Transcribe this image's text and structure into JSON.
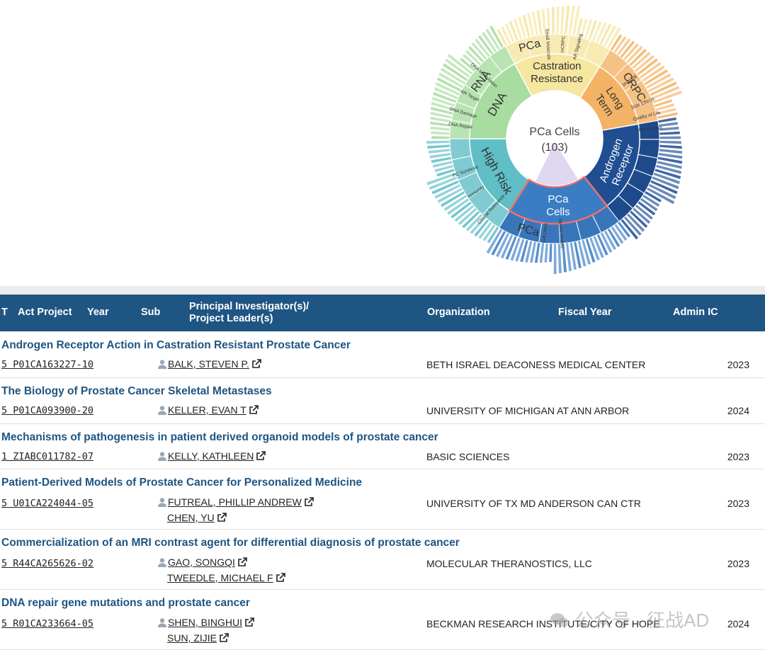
{
  "sunburst": {
    "center_line1": "PCa Cells",
    "center_line2": "(103)",
    "colors": {
      "dna": "#a8dca0",
      "cr": "#f5e6a0",
      "lt": "#f4b266",
      "ar": "#1f4e93",
      "cells": "#3b7dc4",
      "hr": "#5fbec6",
      "center_wedge": "#e0d8f0"
    },
    "inner": [
      {
        "label": [
          "DNA"
        ],
        "color": "#a8dca0",
        "text": "#333"
      },
      {
        "label": [
          "Castration",
          "Resistance"
        ],
        "color": "#f5e6a0",
        "text": "#333"
      },
      {
        "label": [
          "Long",
          "Term"
        ],
        "color": "#f4b266",
        "text": "#333"
      },
      {
        "label": [
          "Androgen",
          "Receptor"
        ],
        "color": "#1f4e93",
        "text": "#ffffff"
      },
      {
        "label": [
          "PCa",
          "Cells"
        ],
        "color": "#3b7dc4",
        "text": "#ffffff"
      },
      {
        "label": [
          "High Risk"
        ],
        "color": "#5fbec6",
        "text": "#333"
      }
    ],
    "outer_labels": [
      "RNA",
      "PCa",
      "CRPC",
      "PCa"
    ],
    "small_labels": [
      "DNA Repair",
      "DNA Damage",
      "AR Target",
      "DNA Methylation",
      "Clinical Trials",
      "Imaging",
      "Side Effects",
      "Quality of Life",
      "mCRPC",
      "Small Molecule",
      "AR Signaling",
      "PC Survivors",
      "Immunity",
      "Clinical Relevance",
      "Cell Lines",
      "Mouse Models"
    ]
  },
  "table": {
    "headers": {
      "t": "T",
      "act_project": "Act Project",
      "year": "Year",
      "sub": "Sub",
      "pi_line1": "Principal Investigator(s)/",
      "pi_line2": "Project Leader(s)",
      "organization": "Organization",
      "fiscal_year": "Fiscal Year",
      "admin_ic": "Admin IC"
    },
    "rows": [
      {
        "title": "Androgen Receptor Action in Castration Resistant Prostate Cancer",
        "project": "5 P01CA163227-10",
        "pis": [
          "BALK, STEVEN P."
        ],
        "org": "BETH ISRAEL DEACONESS MEDICAL CENTER",
        "year": "2023"
      },
      {
        "title": "The Biology of Prostate Cancer Skeletal Metastases",
        "project": "5 P01CA093900-20",
        "pis": [
          "KELLER, EVAN T"
        ],
        "org": "UNIVERSITY OF MICHIGAN AT ANN ARBOR",
        "year": "2024"
      },
      {
        "title": "Mechanisms of pathogenesis in patient derived organoid models of prostate cancer",
        "project": "1 ZIABC011782-07",
        "pis": [
          "KELLY, KATHLEEN"
        ],
        "org": "BASIC SCIENCES",
        "year": "2023"
      },
      {
        "title": "Patient-Derived Models of Prostate Cancer for Personalized Medicine",
        "project": "5 U01CA224044-05",
        "pis": [
          "FUTREAL, PHILLIP ANDREW",
          "CHEN, YU"
        ],
        "org": "UNIVERSITY OF TX MD ANDERSON CAN CTR",
        "year": "2023"
      },
      {
        "title": "Commercialization of an MRI contrast agent for differential diagnosis of prostate cancer",
        "project": "5 R44CA265626-02",
        "pis": [
          "GAO, SONGQI",
          "TWEEDLE, MICHAEL F"
        ],
        "org": "MOLECULAR THERANOSTICS, LLC",
        "year": "2023"
      },
      {
        "title": "DNA repair gene mutations and prostate cancer",
        "project": "5 R01CA233664-05",
        "pis": [
          "SHEN, BINGHUI",
          "SUN, ZIJIE"
        ],
        "org": "BECKMAN RESEARCH INSTITUTE/CITY OF HOPE",
        "year": "2024"
      }
    ]
  },
  "watermark": "公众号 · 征战AD"
}
